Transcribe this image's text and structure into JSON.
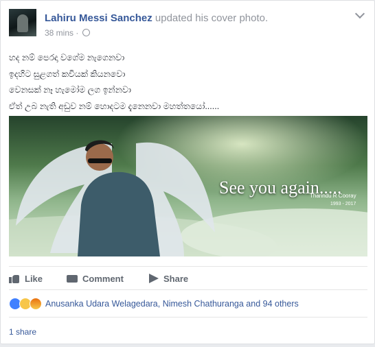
{
  "post": {
    "author": "Lahiru Messi Sanchez",
    "action": "updated his cover photo.",
    "time": "38 mins",
    "separator": "·",
    "privacy_icon": "globe-icon",
    "menu_icon": "chevron-down-icon"
  },
  "text_lines": [
    "හද නම් පෙරදා වගේම නැගෙනවා",
    "ඉදහිට සුළගත් කවියක් කියනවො",
    "වෙනසක් නෑ හැමෝම ලග ඉන්නවා",
    "ඒත් උබ නැති අඩුව නම් හොදටම දැනෙනවා මහත්තයෝ......"
  ],
  "photo": {
    "caption": "See you again.....",
    "credit": "Tharindu R Cooray",
    "years": "1993 - 2017"
  },
  "actions": {
    "like": "Like",
    "comment": "Comment",
    "share": "Share"
  },
  "reactions": {
    "icons": [
      "like-reaction-icon",
      "sad-reaction-icon",
      "angry-reaction-icon"
    ],
    "summary": "Anusanka Udara Welagedara, Nimesh Chathuranga and 94 others"
  },
  "shares": "1 share",
  "colors": {
    "link": "#365899",
    "meta": "#90949c",
    "text": "#1d2129",
    "action": "#606770"
  }
}
